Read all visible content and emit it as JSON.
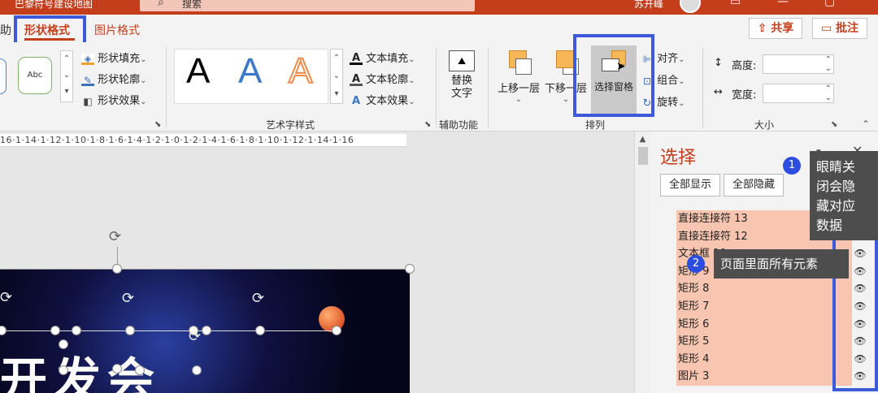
{
  "titlebar": {
    "file_title": "巴黎符号建设地图",
    "search_placeholder": "搜索",
    "user_name": "苏开峰"
  },
  "tabs": {
    "partial_left": "助",
    "shape_format": "形状格式",
    "picture_format": "图片格式"
  },
  "topbar": {
    "share": "共享",
    "comments": "批注"
  },
  "ribbon": {
    "shape_styles": {
      "sample_label": "Abc",
      "shape_fill": "形状填充",
      "shape_outline": "形状轮廓",
      "shape_effects": "形状效果"
    },
    "wordart": {
      "sample_letter": "A",
      "text_fill": "文本填充",
      "text_outline": "文本轮廓",
      "text_effects": "文本效果",
      "group_label": "艺术字样式"
    },
    "accessibility": {
      "alt_text": "替换\n文字",
      "group_label": "辅助功能"
    },
    "arrange": {
      "bring_forward": "上移一层",
      "send_backward": "下移一层",
      "selection_pane": "选择窗格",
      "align": "对齐",
      "group": "组合",
      "rotate": "旋转",
      "group_label": "排列"
    },
    "size": {
      "height_label": "高度:",
      "width_label": "宽度:",
      "group_label": "大小"
    }
  },
  "ruler": {
    "text": "16·1·14·1·12·1·10·1·8·1·6·1·4·1·2·1·0·1·2·1·4·1·6·1·8·1·10·1·12·1·14·1·16"
  },
  "selection_pane": {
    "title": "选择",
    "show_all": "全部显示",
    "hide_all": "全部隐藏",
    "items": [
      {
        "label": "直接连接符 13",
        "icon": "eye-icon"
      },
      {
        "label": "直接连接符 12",
        "icon": "eye-icon"
      },
      {
        "label": "文本框 10",
        "icon": "eye-icon"
      },
      {
        "label": "矩形 9",
        "icon": "eye-icon"
      },
      {
        "label": "矩形 8",
        "icon": "eye-icon"
      },
      {
        "label": "矩形 7",
        "icon": "eye-icon"
      },
      {
        "label": "矩形 6",
        "icon": "eye-icon"
      },
      {
        "label": "矩形 5",
        "icon": "eye-icon"
      },
      {
        "label": "矩形 4",
        "icon": "eye-icon"
      },
      {
        "label": "图片 3",
        "icon": "eye-icon"
      }
    ]
  },
  "annotations": {
    "callout1_number": "1",
    "callout1_text": "眼睛关\n闭会隐\n藏对应\n数据",
    "callout2_number": "2",
    "callout2_text": "页面里面所有元素"
  },
  "slide": {
    "visible_text": "开发会"
  },
  "colors": {
    "accent": "#c43e1c",
    "highlight_box": "#3d5bd8",
    "pane_row": "#f8c6b0",
    "callout_badge": "#2c4ee0"
  }
}
